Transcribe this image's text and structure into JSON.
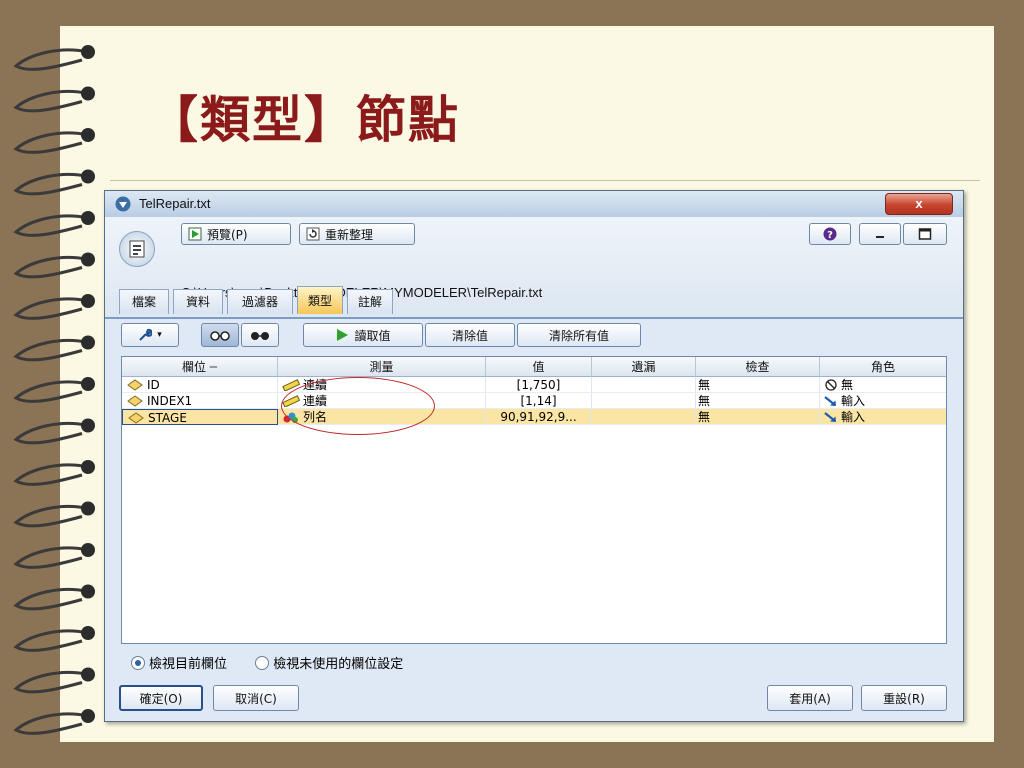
{
  "slide": {
    "title": "【類型】節點"
  },
  "window": {
    "title": "TelRepair.txt",
    "close_label": "x",
    "toolbar": {
      "preview_label": "預覽(P)",
      "refresh_label": "重新整理"
    },
    "path": "C:\\Users\\user\\Desktop\\MODELER\\MYMODELER\\TelRepair.txt",
    "tabs": [
      {
        "label": "檔案"
      },
      {
        "label": "資料"
      },
      {
        "label": "過濾器"
      },
      {
        "label": "類型",
        "active": true
      },
      {
        "label": "註解"
      }
    ],
    "actions": {
      "read_values": "讀取值",
      "clear_values": "清除值",
      "clear_all_values": "清除所有值"
    },
    "grid": {
      "columns": [
        "欄位",
        "測量",
        "值",
        "遺漏",
        "檢查",
        "角色"
      ],
      "rows": [
        {
          "field": "ID",
          "measure": "連續",
          "value": "[1,750]",
          "missing": "",
          "check": "無",
          "role": "無",
          "role_icon": "none-icon"
        },
        {
          "field": "INDEX1",
          "measure": "連續",
          "value": "[1,14]",
          "missing": "",
          "check": "無",
          "role": "輸入",
          "role_icon": "input-arrow-icon"
        },
        {
          "field": "STAGE",
          "measure": "列名",
          "value": "90,91,92,9...",
          "missing": "",
          "check": "無",
          "role": "輸入",
          "role_icon": "input-arrow-icon",
          "selected": true
        }
      ]
    },
    "radios": {
      "view_current": "檢視目前欄位",
      "view_unused": "檢視未使用的欄位設定",
      "selected": "view_current"
    },
    "footer": {
      "ok": "確定(O)",
      "cancel": "取消(C)",
      "apply": "套用(A)",
      "reset": "重設(R)"
    }
  },
  "colors": {
    "title_red": "#8b1a1a",
    "selection": "#fbe5a5",
    "annotation_circle": "#c0282a"
  }
}
